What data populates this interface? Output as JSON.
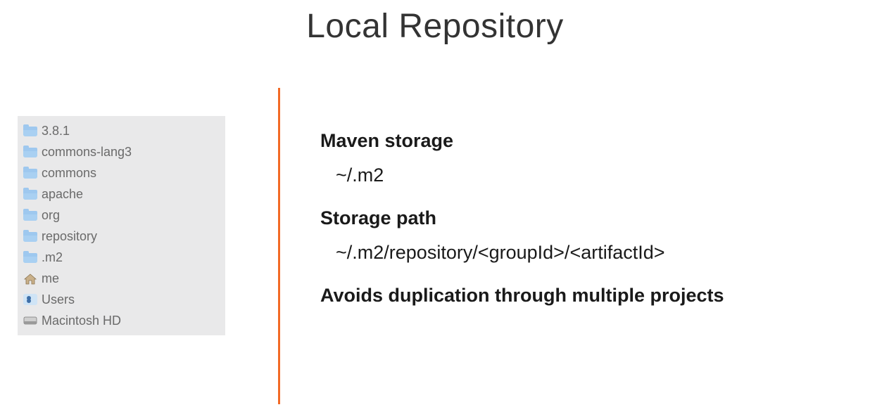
{
  "title": "Local Repository",
  "folders": [
    {
      "icon": "folder",
      "label": "3.8.1"
    },
    {
      "icon": "folder",
      "label": "commons-lang3"
    },
    {
      "icon": "folder",
      "label": "commons"
    },
    {
      "icon": "folder",
      "label": "apache"
    },
    {
      "icon": "folder",
      "label": "org"
    },
    {
      "icon": "folder",
      "label": "repository"
    },
    {
      "icon": "folder",
      "label": ".m2"
    },
    {
      "icon": "home",
      "label": "me"
    },
    {
      "icon": "users",
      "label": "Users"
    },
    {
      "icon": "disk",
      "label": "Macintosh HD"
    }
  ],
  "content": {
    "heading1": "Maven storage",
    "path1": "~/.m2",
    "heading2": "Storage path",
    "path2": "~/.m2/repository/<groupId>/<artifactId>",
    "heading3": "Avoids duplication through multiple projects"
  },
  "colors": {
    "divider": "#f26a25",
    "folderIcon": "#9ec8ef"
  }
}
